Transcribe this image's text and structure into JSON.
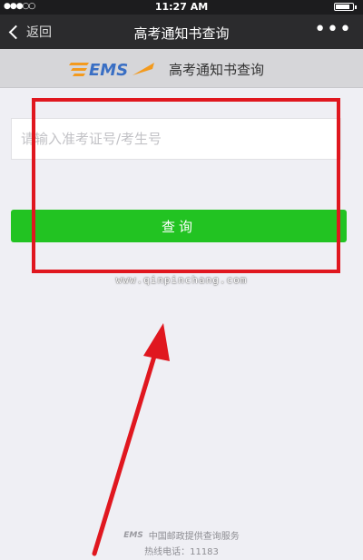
{
  "status_bar": {
    "signal": "●●●○○",
    "time": "11:27 AM",
    "battery_level": 0.85
  },
  "nav": {
    "back_label": "返回",
    "title": "高考通知书查询",
    "more": "•••"
  },
  "header": {
    "logo_text": "EMS",
    "title": "高考通知书查询"
  },
  "form": {
    "placeholder": "请输入准考证号/考生号",
    "value": ""
  },
  "query_button": {
    "label": "查询"
  },
  "watermark": "www.qinpinchang.com",
  "footer": {
    "logo_text": "EMS",
    "service_text": "中国邮政提供查询服务",
    "hotline": "热线电话：11183"
  },
  "colors": {
    "accent_green": "#22c322",
    "annotation_red": "#e0171f",
    "ems_blue": "#3a6fc4",
    "ems_orange": "#f39a1e"
  },
  "icons": [
    "signal-icon",
    "battery-icon",
    "back-chevron-icon",
    "more-icon",
    "ems-logo-icon"
  ]
}
